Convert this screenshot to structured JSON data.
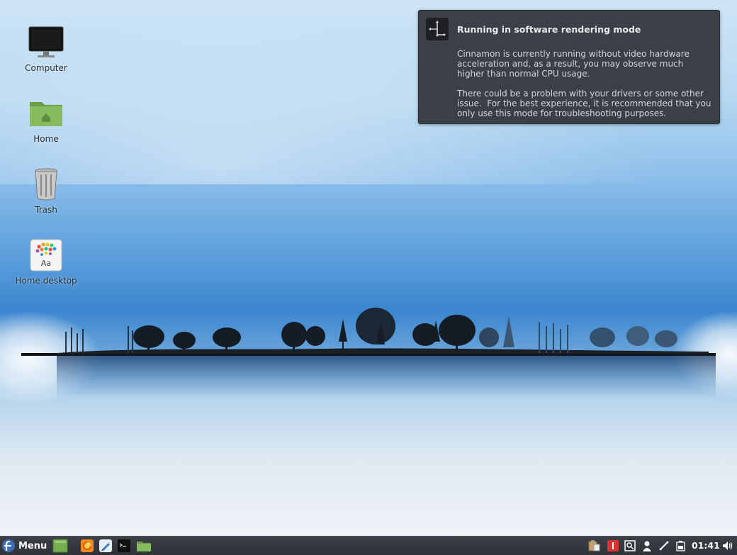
{
  "desktop": {
    "icons": [
      {
        "label": "Computer",
        "icon": "computer-monitor-icon"
      },
      {
        "label": "Home",
        "icon": "home-folder-icon"
      },
      {
        "label": "Trash",
        "icon": "trash-can-icon"
      },
      {
        "label": "Home.desktop",
        "icon": "font-viewer-icon"
      }
    ],
    "font_icon_glyph": "Aa"
  },
  "notification": {
    "icon": "display-settings-icon",
    "title": "Running in software rendering mode",
    "body_paragraph_1": "Cinnamon is currently running without video hardware acceleration and, as a result, you may observe much higher than normal CPU usage.",
    "body_paragraph_2": "There could be a problem with your drivers or some other issue.  For the best experience, it is recommended that you only use this mode for troubleshooting purposes."
  },
  "panel": {
    "menu_label": "Menu",
    "menu_icon": "fedora-logo-icon",
    "launchers": [
      {
        "name": "show-desktop-icon"
      },
      {
        "name": "firefox-icon"
      },
      {
        "name": "text-editor-icon"
      },
      {
        "name": "terminal-icon"
      },
      {
        "name": "files-icon"
      }
    ],
    "tray": [
      {
        "name": "clipboard-icon"
      },
      {
        "name": "update-notifier-icon"
      },
      {
        "name": "workspace-switcher-icon"
      },
      {
        "name": "user-icon"
      },
      {
        "name": "network-icon"
      },
      {
        "name": "battery-icon"
      },
      {
        "name": "volume-icon"
      }
    ],
    "clock": "01:41"
  },
  "colors": {
    "panel_bg": "#33363c",
    "notification_bg": "#3b3f47",
    "folder_green": "#7fb55a",
    "sky_blue": "#3c86cf"
  }
}
